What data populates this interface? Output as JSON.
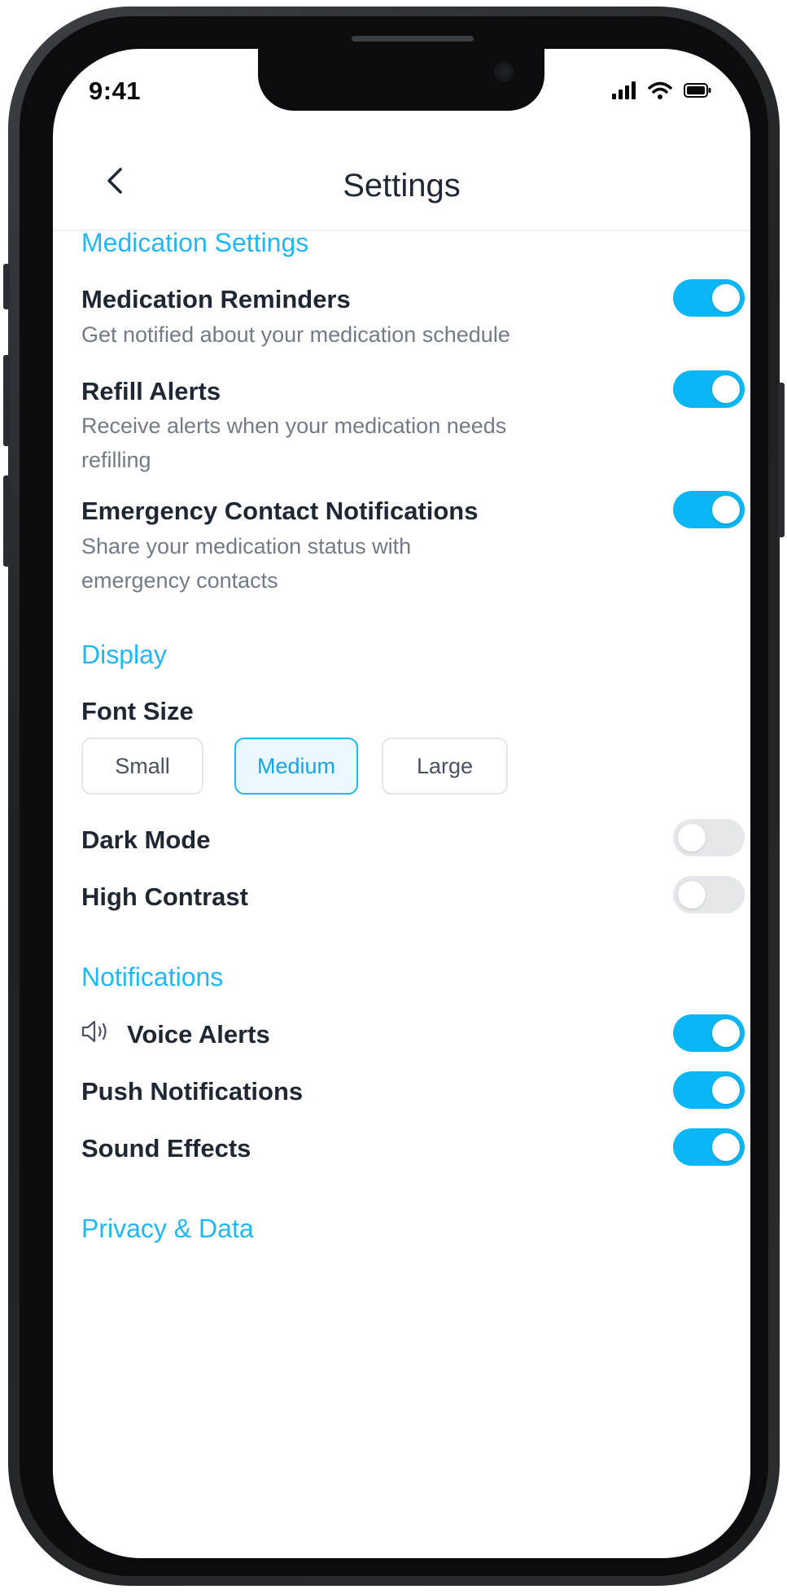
{
  "status_bar": {
    "time": "9:41"
  },
  "header": {
    "title": "Settings"
  },
  "medication": {
    "title": "Medication Settings",
    "items": [
      {
        "label": "Medication Reminders",
        "desc": "Get notified about your medication schedule",
        "on": true
      },
      {
        "label": "Refill Alerts",
        "desc": "Receive alerts when your medication needs refilling",
        "on": true
      },
      {
        "label": "Emergency Contact Notifications",
        "desc": "Share your medication status with emergency contacts",
        "on": true
      }
    ]
  },
  "display": {
    "title": "Display",
    "font_size_label": "Font Size",
    "font_sizes": [
      "Small",
      "Medium",
      "Large"
    ],
    "selected_font_size": "Medium",
    "dark_mode": {
      "label": "Dark Mode",
      "on": false
    },
    "high_contrast": {
      "label": "High Contrast",
      "on": false
    }
  },
  "notifications": {
    "title": "Notifications",
    "voice_alerts": {
      "label": "Voice Alerts",
      "icon": "speaker-icon",
      "on": true
    },
    "push": {
      "label": "Push Notifications",
      "on": true
    },
    "sound": {
      "label": "Sound Effects",
      "on": true
    }
  },
  "privacy": {
    "title": "Privacy & Data"
  },
  "colors": {
    "accent": "#20b7f4",
    "toggle_on": "#0bb6f4",
    "toggle_off": "#e5e7ea"
  }
}
